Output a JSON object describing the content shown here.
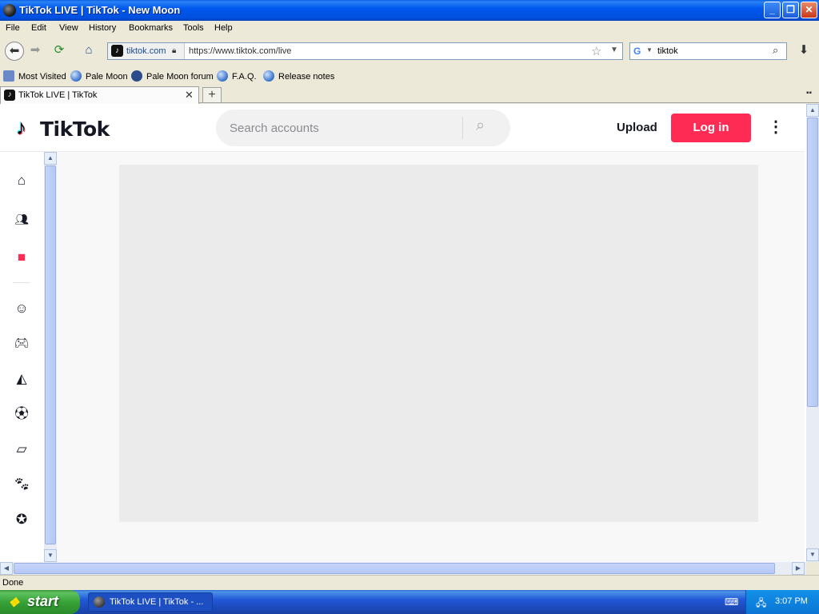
{
  "window": {
    "title": "TikTok LIVE | TikTok - New Moon"
  },
  "menu": {
    "items": [
      "File",
      "Edit",
      "View",
      "History",
      "Bookmarks",
      "Tools",
      "Help"
    ]
  },
  "nav": {
    "back_icon": "arrow-left-icon",
    "forward_icon": "arrow-right-icon",
    "reload_icon": "reload-icon",
    "home_icon": "home-icon",
    "identity_domain": "tiktok.com",
    "url": "https://www.tiktok.com/live",
    "search_value": "tiktok"
  },
  "bookmarks": [
    "Most Visited",
    "Pale Moon",
    "Pale Moon forum",
    "F.A.Q.",
    "Release notes"
  ],
  "tabs": [
    {
      "label": "TikTok LIVE | TikTok"
    }
  ],
  "tiktok": {
    "logo_text": "TikTok",
    "search_placeholder": "Search accounts",
    "upload_label": "Upload",
    "login_label": "Log in",
    "sidebar_icons": [
      "home-icon",
      "following-icon",
      "live-icon",
      "comedy-icon",
      "gaming-icon",
      "food-icon",
      "sports-icon",
      "beauty-icon",
      "animals-icon",
      "achievement-icon"
    ],
    "accent_color": "#fe2c55"
  },
  "status": {
    "text": "Done"
  },
  "taskbar": {
    "start_label": "start",
    "task_label": "TikTok LIVE | TikTok - ...",
    "clock": "3:07 PM"
  }
}
